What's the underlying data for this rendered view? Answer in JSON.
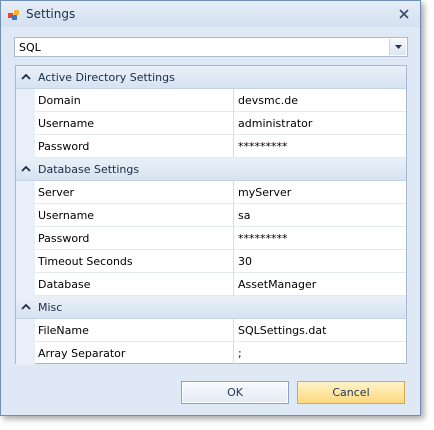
{
  "window": {
    "title": "Settings"
  },
  "selector": {
    "value": "SQL"
  },
  "categories": [
    {
      "label": "Active Directory Settings",
      "properties": [
        {
          "name": "Domain",
          "value": "devsmc.de"
        },
        {
          "name": "Username",
          "value": "administrator"
        },
        {
          "name": "Password",
          "value": "*********"
        }
      ]
    },
    {
      "label": "Database Settings",
      "properties": [
        {
          "name": "Server",
          "value": "myServer"
        },
        {
          "name": "Username",
          "value": "sa"
        },
        {
          "name": "Password",
          "value": "*********"
        },
        {
          "name": "Timeout Seconds",
          "value": "30"
        },
        {
          "name": "Database",
          "value": "AssetManager"
        }
      ]
    },
    {
      "label": "Misc",
      "properties": [
        {
          "name": "FileName",
          "value": "SQLSettings.dat"
        },
        {
          "name": "Array Separator",
          "value": ";"
        }
      ]
    }
  ],
  "buttons": {
    "ok": "OK",
    "cancel": "Cancel"
  },
  "icons": {
    "app": "settings-app-icon",
    "close": "close-icon",
    "dropdown": "chevron-down-icon",
    "collapse": "chevron-up-icon"
  }
}
